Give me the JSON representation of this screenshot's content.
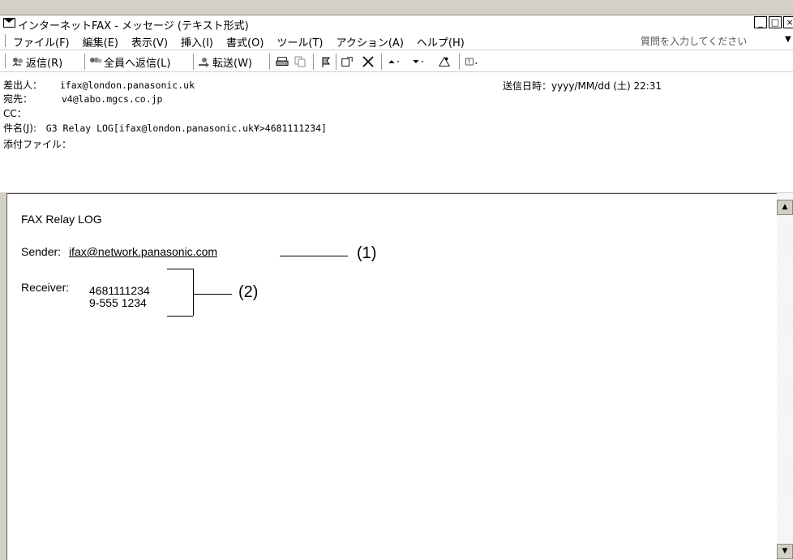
{
  "window": {
    "title": "インターネットFAX - メッセージ (テキスト形式)",
    "min_label": "_",
    "max_label": "□",
    "close_label": "×"
  },
  "menubar": {
    "items": [
      "ファイル(F)",
      "編集(E)",
      "表示(V)",
      "挿入(I)",
      "書式(O)",
      "ツール(T)",
      "アクション(A)",
      "ヘルプ(H)"
    ],
    "ask_placeholder": "質問を入力してください"
  },
  "toolbar": {
    "reply": "返信(R)",
    "reply_all": "全員へ返信(L)",
    "forward": "転送(W)"
  },
  "header": {
    "from_label": "差出人：",
    "from_value": "ifax@london.panasonic.uk",
    "to_label": "宛先：",
    "to_value": "v4@labo.mgcs.co.jp",
    "cc_label": "CC：",
    "subject_label": "件名(J):",
    "subject_value": "G3 Relay LOG[ifax@london.panasonic.uk¥>4681111234]",
    "attach_label": "添付ファイル：",
    "sent_label": "送信日時：",
    "sent_value": "yyyy/MM/dd (土) 22:31"
  },
  "body": {
    "heading": "FAX Relay LOG",
    "sender_label": "Sender:",
    "sender_value": "ifax@network.panasonic.com",
    "receiver_label": "Receiver:",
    "receiver_lines": [
      "4681111234",
      "9-555 1234"
    ],
    "callout_1": "(1)",
    "callout_2": "(2)"
  }
}
